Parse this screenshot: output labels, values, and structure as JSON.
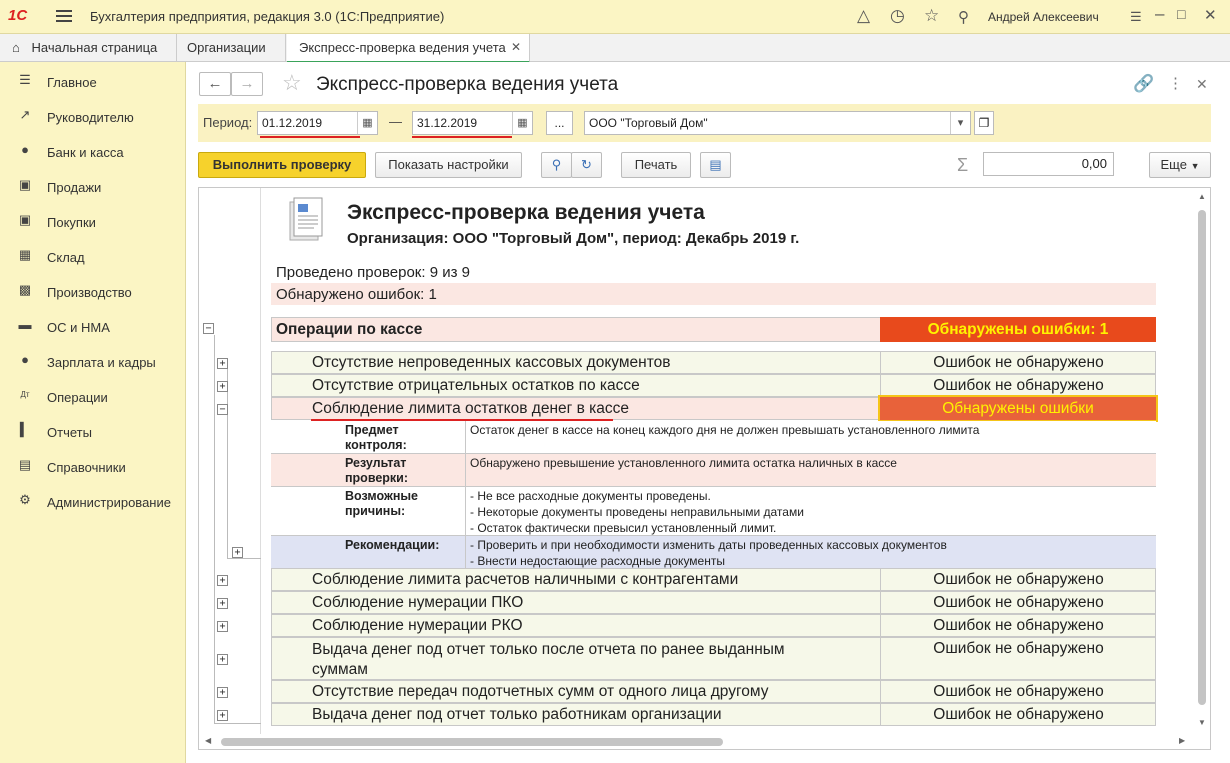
{
  "app": {
    "logo": "1С",
    "title": "Бухгалтерия предприятия, редакция 3.0  (1С:Предприятие)",
    "user": "Андрей Алексеевич"
  },
  "tabs": [
    {
      "label": "Начальная страница"
    },
    {
      "label": "Организации"
    },
    {
      "label": "Экспресс-проверка ведения учета"
    }
  ],
  "sidebar": {
    "items": [
      {
        "label": "Главное",
        "icon": "menu-icon"
      },
      {
        "label": "Руководителю",
        "icon": "trend-icon"
      },
      {
        "label": "Банк и касса",
        "icon": "ruble-icon"
      },
      {
        "label": "Продажи",
        "icon": "bag-icon"
      },
      {
        "label": "Покупки",
        "icon": "cart-icon"
      },
      {
        "label": "Склад",
        "icon": "warehouse-icon"
      },
      {
        "label": "Производство",
        "icon": "factory-icon"
      },
      {
        "label": "ОС и НМА",
        "icon": "truck-icon"
      },
      {
        "label": "Зарплата и кадры",
        "icon": "person-icon"
      },
      {
        "label": "Операции",
        "icon": "dt-kt-icon"
      },
      {
        "label": "Отчеты",
        "icon": "bar-chart-icon"
      },
      {
        "label": "Справочники",
        "icon": "book-icon"
      },
      {
        "label": "Администрирование",
        "icon": "gear-icon"
      }
    ]
  },
  "form": {
    "title": "Экспресс-проверка ведения учета",
    "period_label": "Период:",
    "date_from": "01.12.2019",
    "dash": "—",
    "date_to": "31.12.2019",
    "ellipsis": "...",
    "organization": "ООО \"Торговый Дом\"",
    "buttons": {
      "run": "Выполнить проверку",
      "settings": "Показать настройки",
      "print": "Печать",
      "more": "Еще",
      "sum_value": "0,00",
      "sigma": "Σ"
    }
  },
  "report": {
    "title": "Экспресс-проверка ведения учета",
    "subtitle": "Организация: ООО \"Торговый Дом\", период: Декабрь 2019 г.",
    "checks_done": "Проведено проверок: 9 из 9",
    "errors_found": "Обнаружено ошибок: 1",
    "section": {
      "name": "Операции по кассе",
      "status": "Обнаружены ошибки: 1"
    },
    "rows_top": [
      {
        "name": "Отсутствие непроведенных кассовых документов",
        "status": "Ошибок не обнаружено"
      },
      {
        "name": "Отсутствие отрицательных остатков по кассе",
        "status": "Ошибок не обнаружено"
      }
    ],
    "error_row": {
      "name": "Соблюдение лимита остатков денег в кассе",
      "status": "Обнаружены ошибки"
    },
    "details": [
      {
        "key": "Предмет контроля:",
        "value": "Остаток денег в кассе на конец каждого дня не должен превышать установленного лимита"
      },
      {
        "key": "Результат проверки:",
        "value": "Обнаружено превышение установленного лимита остатка наличных в кассе"
      },
      {
        "key": "Возможные причины:",
        "lines": [
          "- Не все расходные документы проведены.",
          "- Некоторые документы проведены неправильными датами",
          "- Остаток фактически превысил установленный лимит."
        ]
      },
      {
        "key": "Рекомендации:",
        "lines": [
          "- Проверить и при необходимости изменить даты проведенных кассовых документов",
          "- Внести недостающие расходные документы"
        ]
      }
    ],
    "rows_bottom": [
      {
        "name": "Соблюдение лимита расчетов наличными с контрагентами",
        "status": "Ошибок не обнаружено"
      },
      {
        "name": "Соблюдение нумерации ПКО",
        "status": "Ошибок не обнаружено"
      },
      {
        "name": "Соблюдение нумерации РКО",
        "status": "Ошибок не обнаружено"
      },
      {
        "name": "Выдача денег под отчет только после отчета по ранее выданным суммам",
        "name_line1": "Выдача денег под отчет только после отчета по ранее выданным",
        "name_line2": "суммам",
        "status": "Ошибок не обнаружено"
      },
      {
        "name": "Отсутствие передач подотчетных сумм от одного лица другому",
        "status": "Ошибок не обнаружено"
      },
      {
        "name": "Выдача денег под отчет только работникам организации",
        "status": "Ошибок не обнаружено"
      }
    ]
  },
  "colors": {
    "accent_yellow": "#f6d22c",
    "error_red": "#e84a1c",
    "section_bg": "#fbe7e2",
    "row_bg": "#f6f8e9",
    "recommend_bg": "#dfe3f3"
  }
}
